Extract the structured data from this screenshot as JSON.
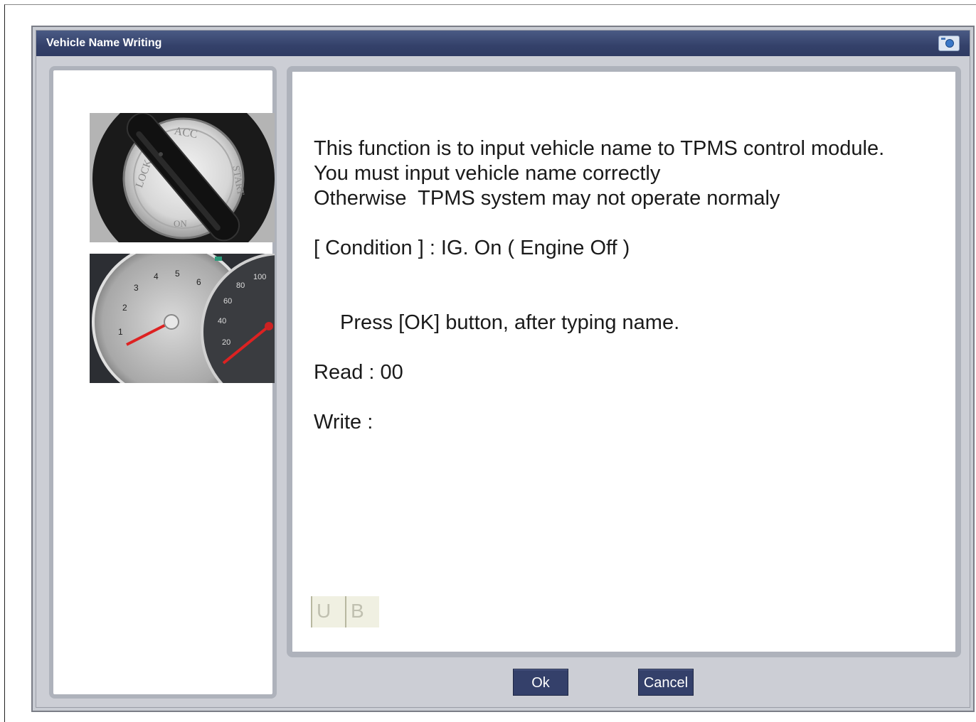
{
  "window": {
    "title": "Vehicle Name Writing",
    "icon": "camera-icon"
  },
  "images": {
    "ignition": {
      "icon": "ignition-switch-image",
      "labels": [
        "ACC",
        "LOCK",
        "START",
        "ON"
      ]
    },
    "dashboard": {
      "icon": "instrument-cluster-image",
      "tach_labels": [
        "1",
        "2",
        "3",
        "4",
        "5",
        "6"
      ],
      "speed_labels": [
        "20",
        "40",
        "60",
        "80",
        "100"
      ]
    }
  },
  "message": {
    "line1": "This function is to input vehicle name to TPMS control module.",
    "line2": "You must input vehicle name correctly",
    "line3": "Otherwise  TPMS system may not operate normaly",
    "condition": "[ Condition ] : IG. On ( Engine Off )",
    "instruction": "Press [OK] button, after typing name.",
    "read": "Read : 00",
    "write": "Write :"
  },
  "input_fields": [
    "U",
    "B"
  ],
  "buttons": {
    "ok": "Ok",
    "cancel": "Cancel"
  },
  "colors": {
    "titlebar": "#34416a",
    "button": "#34406a",
    "panel_border": "#aeb2bb"
  }
}
